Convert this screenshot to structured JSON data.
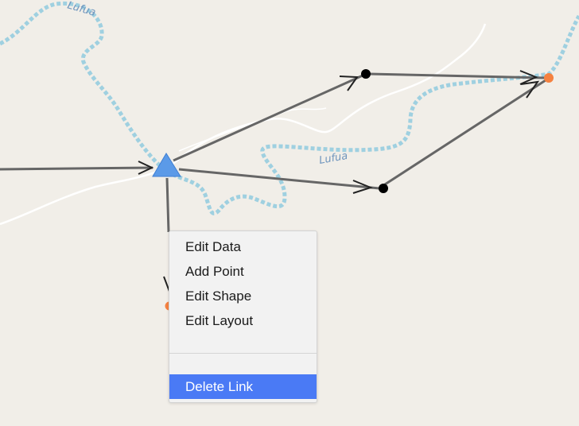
{
  "map": {
    "river_labels": [
      "Lufua",
      "Lufua"
    ],
    "colors": {
      "background": "#f1eee8",
      "river": "#9fd0e0",
      "link": "#666666",
      "node_black": "#000000",
      "node_orange": "#f5813f",
      "node_triangle": "#5b9ae8"
    }
  },
  "context_menu": {
    "items": [
      "Edit Data",
      "Add Point",
      "Edit Shape",
      "Edit Layout"
    ],
    "highlighted_item": "Delete Link",
    "highlight_color": "#4a7af5"
  }
}
